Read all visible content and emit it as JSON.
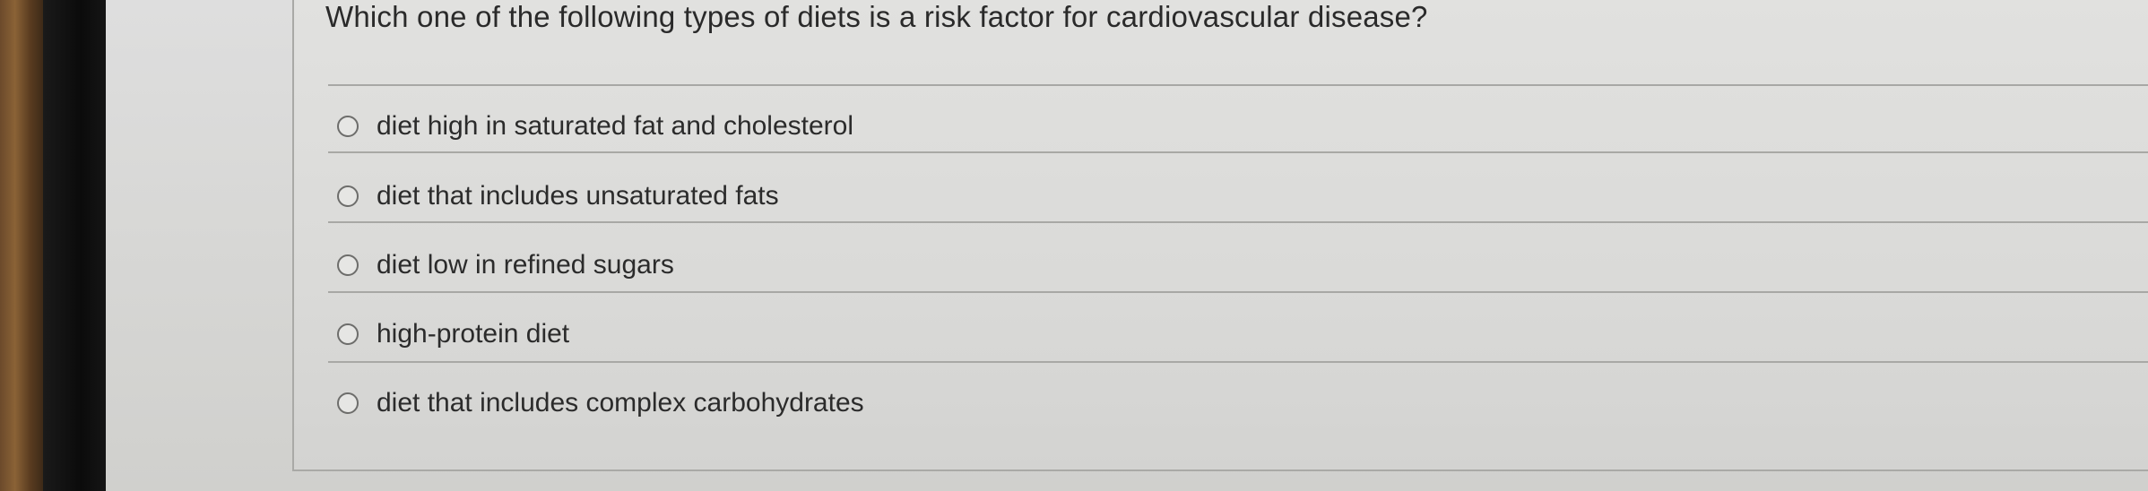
{
  "question": {
    "text": "Which one of the following types of diets is a risk factor for cardiovascular disease?"
  },
  "options": [
    {
      "label": "diet high in saturated fat and cholesterol",
      "selected": false
    },
    {
      "label": "diet that includes unsaturated fats",
      "selected": false
    },
    {
      "label": "diet low in refined sugars",
      "selected": false
    },
    {
      "label": "high-protein diet",
      "selected": false
    },
    {
      "label": "diet that includes complex carbohydrates",
      "selected": false
    }
  ]
}
